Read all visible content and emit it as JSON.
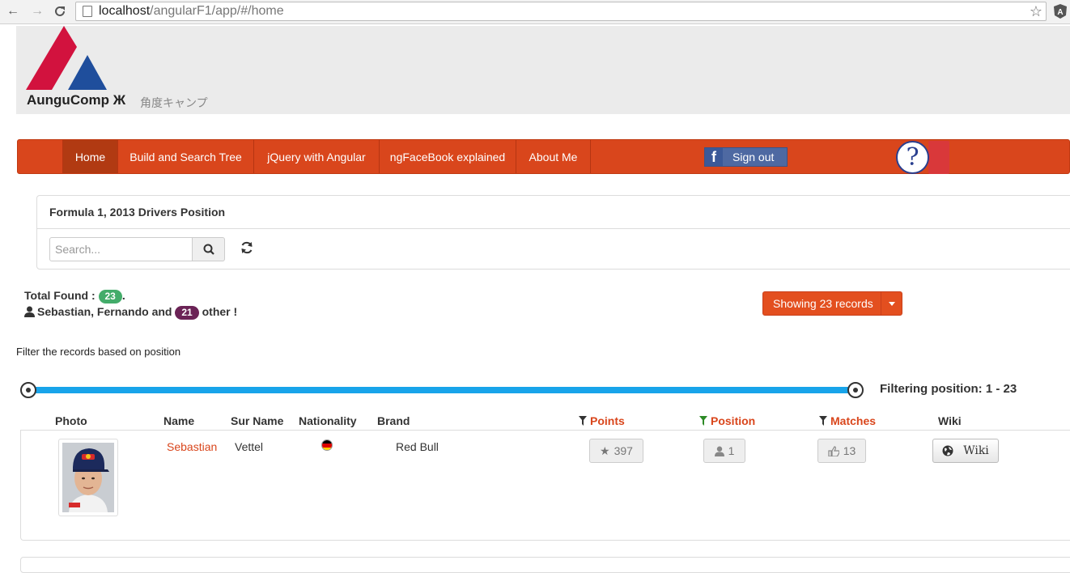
{
  "browser": {
    "url_host": "localhost",
    "url_path": "/angularF1/app/#/home"
  },
  "brand": {
    "title": "AunguComp Ж",
    "subtitle": "角度キャンプ",
    "colors": {
      "red": "#d2123e",
      "blue": "#1f4e9c"
    }
  },
  "navbar": {
    "items": [
      {
        "label": "Home",
        "active": true
      },
      {
        "label": "Build and Search Tree"
      },
      {
        "label": "jQuery with Angular"
      },
      {
        "label": "ngFaceBook explained"
      },
      {
        "label": "About Me"
      }
    ],
    "facebook_label": "Sign out",
    "help_symbol": "?",
    "accent": "#d9461c"
  },
  "panel": {
    "title": "Formula 1, 2013 Drivers Position",
    "search_placeholder": "Search..."
  },
  "summary": {
    "total_label": "Total Found :",
    "total_count": "23",
    "total_suffix": ".",
    "names_text": "Sebastian, Fernando and",
    "other_count": "21",
    "other_suffix": "other !",
    "showing_label": "Showing 23 records"
  },
  "filter": {
    "hint": "Filter the records based on position",
    "range_label": "Filtering position: 1 - 23",
    "range_min": 1,
    "range_max": 23
  },
  "table": {
    "headers": {
      "photo": "Photo",
      "name": "Name",
      "surname": "Sur Name",
      "nationality": "Nationality",
      "brand": "Brand",
      "points": "Points",
      "position": "Position",
      "matches": "Matches",
      "wiki": "Wiki"
    },
    "rows": [
      {
        "name": "Sebastian",
        "surname": "Vettel",
        "nationality_flag": "germany-flag",
        "brand": "Red Bull",
        "points": "397",
        "position": "1",
        "matches": "13",
        "wiki_label": "Wiki"
      }
    ]
  }
}
